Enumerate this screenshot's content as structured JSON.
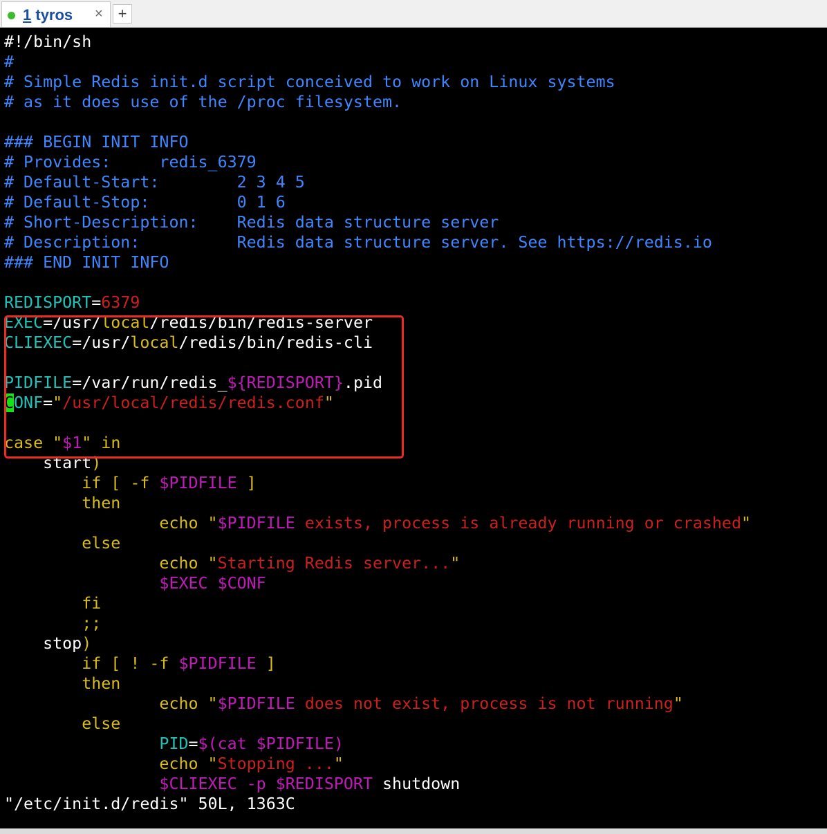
{
  "tab": {
    "index": "1",
    "name": "tyros",
    "close": "×",
    "add": "+"
  },
  "lines": [
    [
      [
        "w",
        "#!/bin/sh"
      ]
    ],
    [
      [
        "b",
        "#"
      ]
    ],
    [
      [
        "b",
        "# Simple Redis init.d script conceived to work on Linux systems"
      ]
    ],
    [
      [
        "b",
        "# as it does use of the /proc filesystem."
      ]
    ],
    [],
    [
      [
        "b",
        "### BEGIN INIT INFO"
      ]
    ],
    [
      [
        "b",
        "# Provides:     redis_6379"
      ]
    ],
    [
      [
        "b",
        "# Default-Start:        2 3 4 5"
      ]
    ],
    [
      [
        "b",
        "# Default-Stop:         0 1 6"
      ]
    ],
    [
      [
        "b",
        "# Short-Description:    Redis data structure server"
      ]
    ],
    [
      [
        "b",
        "# Description:          Redis data structure server. See https://redis.io"
      ]
    ],
    [
      [
        "b",
        "### END INIT INFO"
      ]
    ],
    [],
    [
      [
        "c",
        "REDISPORT"
      ],
      [
        "w",
        "="
      ],
      [
        "r",
        "6379"
      ]
    ],
    [
      [
        "c",
        "EXEC"
      ],
      [
        "w",
        "=/usr/"
      ],
      [
        "y",
        "local"
      ],
      [
        "w",
        "/redis/bin/redis-server"
      ]
    ],
    [
      [
        "c",
        "CLIEXEC"
      ],
      [
        "w",
        "=/usr/"
      ],
      [
        "y",
        "local"
      ],
      [
        "w",
        "/redis/bin/redis-cli"
      ]
    ],
    [],
    [
      [
        "c",
        "PIDFILE"
      ],
      [
        "w",
        "=/var/run/redis_"
      ],
      [
        "m",
        "${REDISPORT}"
      ],
      [
        "w",
        ".pid"
      ]
    ],
    [
      [
        "cur",
        "C"
      ],
      [
        "c",
        "ONF"
      ],
      [
        "w",
        "="
      ],
      [
        "y",
        "\""
      ],
      [
        "r",
        "/usr/local/redis/redis.conf"
      ],
      [
        "y",
        "\""
      ]
    ],
    [],
    [
      [
        "y",
        "case "
      ],
      [
        "y",
        "\""
      ],
      [
        "m",
        "$1"
      ],
      [
        "y",
        "\""
      ],
      [
        "y",
        " in"
      ]
    ],
    [
      [
        "w",
        "    start"
      ],
      [
        "y",
        ")"
      ]
    ],
    [
      [
        "y",
        "        if [ -f "
      ],
      [
        "m",
        "$PIDFILE"
      ],
      [
        "y",
        " ]"
      ]
    ],
    [
      [
        "y",
        "        then"
      ]
    ],
    [
      [
        "y",
        "                echo "
      ],
      [
        "y",
        "\""
      ],
      [
        "m",
        "$PIDFILE"
      ],
      [
        "r",
        " exists, process is already running or crashed"
      ],
      [
        "y",
        "\""
      ]
    ],
    [
      [
        "y",
        "        else"
      ]
    ],
    [
      [
        "y",
        "                echo "
      ],
      [
        "y",
        "\""
      ],
      [
        "r",
        "Starting Redis server..."
      ],
      [
        "y",
        "\""
      ]
    ],
    [
      [
        "m",
        "                $EXEC $CONF"
      ]
    ],
    [
      [
        "y",
        "        fi"
      ]
    ],
    [
      [
        "y",
        "        ;;"
      ]
    ],
    [
      [
        "w",
        "    stop"
      ],
      [
        "y",
        ")"
      ]
    ],
    [
      [
        "y",
        "        if [ ! -f "
      ],
      [
        "m",
        "$PIDFILE"
      ],
      [
        "y",
        " ]"
      ]
    ],
    [
      [
        "y",
        "        then"
      ]
    ],
    [
      [
        "y",
        "                echo "
      ],
      [
        "y",
        "\""
      ],
      [
        "m",
        "$PIDFILE"
      ],
      [
        "r",
        " does not exist, process is not running"
      ],
      [
        "y",
        "\""
      ]
    ],
    [
      [
        "y",
        "        else"
      ]
    ],
    [
      [
        "c",
        "                PID"
      ],
      [
        "w",
        "="
      ],
      [
        "m",
        "$(cat $PIDFILE)"
      ]
    ],
    [
      [
        "y",
        "                echo "
      ],
      [
        "y",
        "\""
      ],
      [
        "r",
        "Stopping ..."
      ],
      [
        "y",
        "\""
      ]
    ],
    [
      [
        "m",
        "                $CLIEXEC -p $REDISPORT"
      ],
      [
        "w",
        " shutdown"
      ]
    ],
    [
      [
        "w",
        "\"/etc/init.d/redis\" 50L, 1363C"
      ]
    ]
  ]
}
